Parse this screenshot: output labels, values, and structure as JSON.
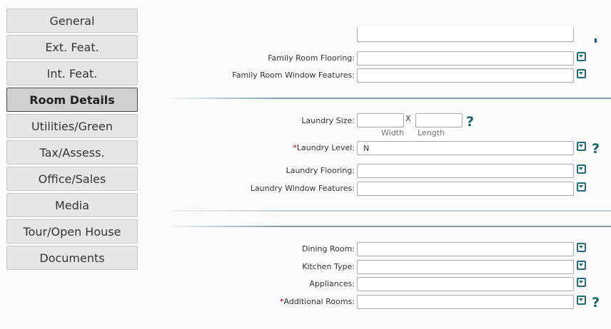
{
  "nav": {
    "items": [
      {
        "label": "General"
      },
      {
        "label": "Ext. Feat."
      },
      {
        "label": "Int. Feat."
      },
      {
        "label": "Room Details"
      },
      {
        "label": "Utilities/Green"
      },
      {
        "label": "Tax/Assess."
      },
      {
        "label": "Office/Sales"
      },
      {
        "label": "Media"
      },
      {
        "label": "Tour/Open House"
      },
      {
        "label": "Documents"
      }
    ],
    "active": "Room Details"
  },
  "family": {
    "flooring_label": "Family Room Flooring:",
    "flooring_value": "",
    "window_label": "Family Room Window Features:",
    "window_value": ""
  },
  "laundry": {
    "size_label": "Laundry Size:",
    "times": "X",
    "width_value": "",
    "length_value": "",
    "width_caption": "Width",
    "length_caption": "Length",
    "required_mark": "*",
    "level_label": "Laundry Level:",
    "level_value": "N",
    "flooring_label": "Laundry Flooring:",
    "flooring_value": "",
    "window_label": "Laundry Window Features:",
    "window_value": ""
  },
  "other": {
    "dining_label": "Dining Room:",
    "dining_value": "",
    "kitchen_label": "Kitchen Type:",
    "kitchen_value": "",
    "appliances_label": "Appliances:",
    "appliances_value": "",
    "required_mark": "*",
    "additional_label": "Additional Rooms:",
    "additional_value": ""
  },
  "help_glyph": "?"
}
